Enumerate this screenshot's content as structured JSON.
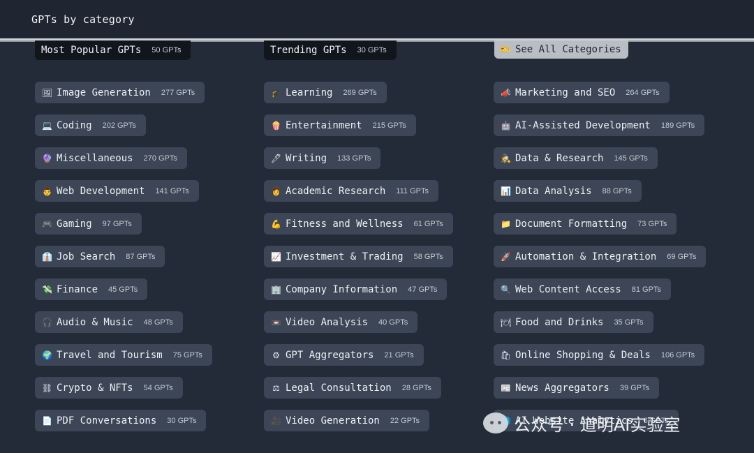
{
  "header": {
    "title": "GPTs by category"
  },
  "tabs": {
    "most_popular": {
      "label": "Most Popular GPTs",
      "count": "50 GPTs"
    },
    "trending": {
      "label": "Trending GPTs",
      "count": "30 GPTs"
    },
    "see_all": {
      "icon": "ticket-icon",
      "glyph": "🎫",
      "label": "See All Categories"
    }
  },
  "columns": [
    [
      {
        "glyph": "🖼",
        "icon": "picture-icon",
        "name": "Image Generation",
        "count": "277 GPTs"
      },
      {
        "glyph": "💻",
        "icon": "laptop-icon",
        "name": "Coding",
        "count": "202 GPTs"
      },
      {
        "glyph": "🔮",
        "icon": "crystal-ball-icon",
        "name": "Miscellaneous",
        "count": "270 GPTs"
      },
      {
        "glyph": "👨",
        "icon": "developer-icon",
        "name": "Web Development",
        "count": "141 GPTs"
      },
      {
        "glyph": "🎮",
        "icon": "gamepad-icon",
        "name": "Gaming",
        "count": "97 GPTs"
      },
      {
        "glyph": "👔",
        "icon": "office-worker-icon",
        "name": "Job Search",
        "count": "87 GPTs"
      },
      {
        "glyph": "💸",
        "icon": "money-icon",
        "name": "Finance",
        "count": "45 GPTs"
      },
      {
        "glyph": "🎧",
        "icon": "headphones-icon",
        "name": "Audio & Music",
        "count": "48 GPTs"
      },
      {
        "glyph": "🌍",
        "icon": "globe-icon",
        "name": "Travel and Tourism",
        "count": "75 GPTs"
      },
      {
        "glyph": "⛓",
        "icon": "chain-icon",
        "name": "Crypto & NFTs",
        "count": "54 GPTs"
      },
      {
        "glyph": "📄",
        "icon": "document-icon",
        "name": "PDF Conversations",
        "count": "30 GPTs"
      }
    ],
    [
      {
        "glyph": "🎓",
        "icon": "graduation-cap-icon",
        "name": "Learning",
        "count": "269 GPTs"
      },
      {
        "glyph": "🍿",
        "icon": "popcorn-icon",
        "name": "Entertainment",
        "count": "215 GPTs"
      },
      {
        "glyph": "🖊",
        "icon": "pen-icon",
        "name": "Writing",
        "count": "133 GPTs"
      },
      {
        "glyph": "👩",
        "icon": "scientist-icon",
        "name": "Academic Research",
        "count": "111 GPTs"
      },
      {
        "glyph": "💪",
        "icon": "flexed-biceps-icon",
        "name": "Fitness and Wellness",
        "count": "61 GPTs"
      },
      {
        "glyph": "📈",
        "icon": "chart-up-icon",
        "name": "Investment & Trading",
        "count": "58 GPTs"
      },
      {
        "glyph": "🏢",
        "icon": "office-building-icon",
        "name": "Company Information",
        "count": "47 GPTs"
      },
      {
        "glyph": "📼",
        "icon": "videocassette-icon",
        "name": "Video Analysis",
        "count": "40 GPTs"
      },
      {
        "glyph": "⚙",
        "icon": "gear-icon",
        "name": "GPT Aggregators",
        "count": "21 GPTs"
      },
      {
        "glyph": "⚖",
        "icon": "scales-icon",
        "name": "Legal Consultation",
        "count": "28 GPTs"
      },
      {
        "glyph": "🎥",
        "icon": "movie-camera-icon",
        "name": "Video Generation",
        "count": "22 GPTs"
      }
    ],
    [
      {
        "glyph": "📣",
        "icon": "megaphone-icon",
        "name": "Marketing and SEO",
        "count": "264 GPTs"
      },
      {
        "glyph": "🤖",
        "icon": "robot-icon",
        "name": "AI-Assisted Development",
        "count": "189 GPTs"
      },
      {
        "glyph": "🕵",
        "icon": "detective-icon",
        "name": "Data & Research",
        "count": "145 GPTs"
      },
      {
        "glyph": "📊",
        "icon": "bar-chart-icon",
        "name": "Data Analysis",
        "count": "88 GPTs"
      },
      {
        "glyph": "📁",
        "icon": "folder-icon",
        "name": "Document Formatting",
        "count": "73 GPTs"
      },
      {
        "glyph": "🚀",
        "icon": "rocket-icon",
        "name": "Automation & Integration",
        "count": "69 GPTs"
      },
      {
        "glyph": "🔍",
        "icon": "magnifier-icon",
        "name": "Web Content Access",
        "count": "81 GPTs"
      },
      {
        "glyph": "🍽",
        "icon": "plate-icon",
        "name": "Food and Drinks",
        "count": "35 GPTs"
      },
      {
        "glyph": "🛍",
        "icon": "shopping-bags-icon",
        "name": "Online Shopping & Deals",
        "count": "106 GPTs"
      },
      {
        "glyph": "📰",
        "icon": "newspaper-icon",
        "name": "News Aggregators",
        "count": "39 GPTs"
      },
      {
        "glyph": "🌐",
        "icon": "web-globe-icon",
        "name": "AI Website Analytics",
        "count": "6 GPTs"
      }
    ]
  ],
  "watermark": {
    "text": "公众号 · 道明AI实验室"
  },
  "colors": {
    "background": "#222b37",
    "chip": "#3c4656",
    "topbar": "#1f2631",
    "see_all_bg": "#b9bec5"
  }
}
